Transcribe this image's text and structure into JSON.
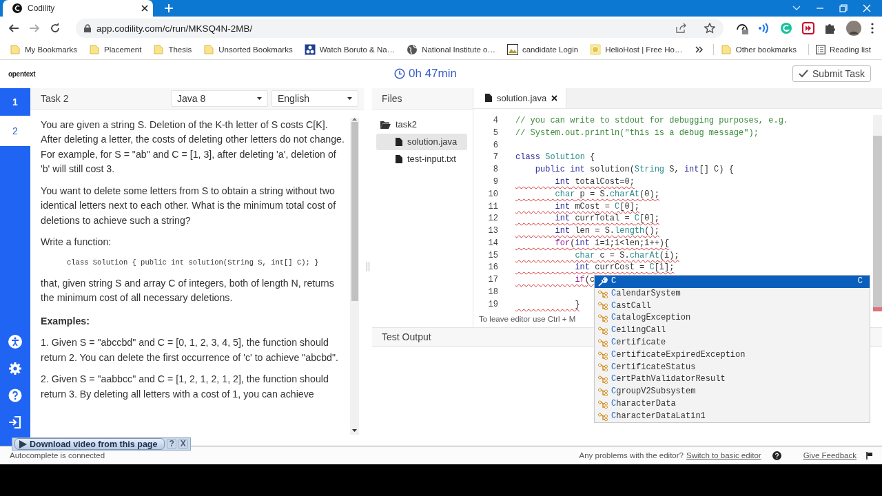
{
  "browser": {
    "tab": {
      "title": "Codility"
    },
    "url": "app.codility.com/c/run/MKSQ4N-2MB/",
    "bookmarks": [
      {
        "label": "My Bookmarks",
        "kind": "folder"
      },
      {
        "label": "Placement",
        "kind": "folder"
      },
      {
        "label": "Thesis",
        "kind": "folder"
      },
      {
        "label": "Unsorted Bookmarks",
        "kind": "folder"
      },
      {
        "label": "Watch Boruto & Na…",
        "kind": "app"
      },
      {
        "label": "National Institute o…",
        "kind": "globe"
      },
      {
        "label": "candidate Login",
        "kind": "image"
      },
      {
        "label": "HelioHost | Free Ho…",
        "kind": "sun"
      }
    ],
    "other_bookmarks": "Other bookmarks",
    "reading_list": "Reading list"
  },
  "header": {
    "brand": "opentext",
    "timer": "0h 47min",
    "submit": "Submit Task"
  },
  "tasks": [
    {
      "label": "1",
      "selected": false
    },
    {
      "label": "2",
      "selected": true
    }
  ],
  "task": {
    "title": "Task 2",
    "language": "Java 8",
    "locale": "English",
    "description": [
      {
        "kind": "text",
        "text": "You are given a string S. Deletion of the K-th letter of S costs C[K]. After deleting a letter, the costs of deleting other letters do not change. For example, for S = \"ab\" and C = [1, 3], after deleting 'a', deletion of 'b' will still cost 3."
      },
      {
        "kind": "text",
        "text": "You want to delete some letters from S to obtain a string without two identical letters next to each other. What is the minimum total cost of deletions to achieve such a string?"
      },
      {
        "kind": "text",
        "text": "Write a function:"
      },
      {
        "kind": "code",
        "text": "class Solution { public int solution(String S, int[] C); }"
      },
      {
        "kind": "text",
        "text": "that, given string S and array C of integers, both of length N, returns the minimum cost of all necessary deletions."
      },
      {
        "kind": "heading",
        "text": "Examples:"
      },
      {
        "kind": "text",
        "text": "1. Given S = \"abccbd\" and C = [0, 1, 2, 3, 4, 5], the function should return 2. You can delete the first occurrence of 'c' to achieve \"abcbd\"."
      },
      {
        "kind": "text",
        "text": "2. Given S = \"aabbcc\" and C = [1, 2, 1, 2, 1, 2], the function should return 3. By deleting all letters with a cost of 1, you can achieve"
      }
    ]
  },
  "files": {
    "heading": "Files",
    "tree": [
      {
        "label": "task2",
        "kind": "folder",
        "expanded": true,
        "selected": false,
        "children": [
          {
            "label": "solution.java",
            "kind": "file",
            "selected": true
          },
          {
            "label": "test-input.txt",
            "kind": "file",
            "selected": false
          }
        ]
      }
    ]
  },
  "editor": {
    "tab": "solution.java",
    "hint": "To leave editor use Ctrl + M",
    "lines": [
      {
        "number": "4",
        "error": false,
        "segments": [
          {
            "kind": "comment",
            "text": "// you can write to stdout for debugging purposes, e.g."
          }
        ]
      },
      {
        "number": "5",
        "error": false,
        "segments": [
          {
            "kind": "comment",
            "text": "// System.out.println(\"this is a debug message\");"
          }
        ]
      },
      {
        "number": "6",
        "error": false
      },
      {
        "number": "7",
        "error": false,
        "segments": [
          {
            "kind": "keyword",
            "text": "class"
          },
          {
            "kind": "ident",
            "text": " Solution"
          },
          {
            "kind": "plain",
            "text": " {"
          }
        ]
      },
      {
        "number": "8",
        "error": false,
        "segments": [
          {
            "kind": "keyword",
            "text": "    public int"
          },
          {
            "kind": "plain",
            "text": " solution("
          },
          {
            "kind": "ident",
            "text": "String"
          },
          {
            "kind": "plain",
            "text": " S, "
          },
          {
            "kind": "keyword",
            "text": "int"
          },
          {
            "kind": "plain",
            "text": "[] C) {"
          }
        ]
      },
      {
        "number": "9",
        "error": true,
        "segments": [
          {
            "kind": "keyword",
            "text": "        int"
          },
          {
            "kind": "plain",
            "text": " totalCost=0;"
          }
        ]
      },
      {
        "number": "10",
        "error": true,
        "segments": [
          {
            "kind": "ident",
            "text": "        char"
          },
          {
            "kind": "plain",
            "text": " p = S."
          },
          {
            "kind": "ident",
            "text": "charAt"
          },
          {
            "kind": "plain",
            "text": "(0);"
          }
        ]
      },
      {
        "number": "11",
        "error": true,
        "segments": [
          {
            "kind": "keyword",
            "text": "        int"
          },
          {
            "kind": "plain",
            "text": " mCost = "
          },
          {
            "kind": "ident",
            "text": "C"
          },
          {
            "kind": "plain",
            "text": "[0];"
          }
        ]
      },
      {
        "number": "12",
        "error": true,
        "segments": [
          {
            "kind": "keyword",
            "text": "        int"
          },
          {
            "kind": "plain",
            "text": " currTotal = "
          },
          {
            "kind": "ident",
            "text": "C"
          },
          {
            "kind": "plain",
            "text": "[0];"
          }
        ]
      },
      {
        "number": "13",
        "error": true,
        "segments": [
          {
            "kind": "keyword",
            "text": "        int"
          },
          {
            "kind": "plain",
            "text": " len = S."
          },
          {
            "kind": "ident",
            "text": "length"
          },
          {
            "kind": "plain",
            "text": "();"
          }
        ]
      },
      {
        "number": "14",
        "error": true,
        "segments": [
          {
            "kind": "control",
            "text": "        for"
          },
          {
            "kind": "plain",
            "text": "("
          },
          {
            "kind": "keyword",
            "text": "int"
          },
          {
            "kind": "plain",
            "text": " i=1;i<len;i++){"
          }
        ]
      },
      {
        "number": "15",
        "error": true,
        "segments": [
          {
            "kind": "ident",
            "text": "            char"
          },
          {
            "kind": "plain",
            "text": " c = S."
          },
          {
            "kind": "ident",
            "text": "charAt"
          },
          {
            "kind": "plain",
            "text": "(i);"
          }
        ]
      },
      {
        "number": "16",
        "error": true,
        "segments": [
          {
            "kind": "keyword",
            "text": "            int"
          },
          {
            "kind": "plain",
            "text": " currCost = "
          },
          {
            "kind": "ident",
            "text": "C"
          },
          {
            "kind": "plain",
            "text": "[i];"
          }
        ]
      },
      {
        "number": "17",
        "error": true,
        "segments": [
          {
            "kind": "control",
            "text": "            if"
          },
          {
            "kind": "plain",
            "text": "(c"
          }
        ]
      },
      {
        "number": "18",
        "error": false
      },
      {
        "number": "19",
        "error": true,
        "segments": [
          {
            "kind": "plain",
            "text": "            }"
          }
        ]
      }
    ],
    "autocomplete": [
      {
        "label": "C",
        "kind": "variable",
        "detail": "C",
        "selected": true
      },
      {
        "label": "CalendarSystem",
        "kind": "class",
        "selected": false
      },
      {
        "label": "CastCall",
        "kind": "class",
        "selected": false
      },
      {
        "label": "CatalogException",
        "kind": "class",
        "selected": false
      },
      {
        "label": "CeilingCall",
        "kind": "class",
        "selected": false
      },
      {
        "label": "Certificate",
        "kind": "class",
        "selected": false
      },
      {
        "label": "CertificateExpiredException",
        "kind": "class",
        "selected": false
      },
      {
        "label": "CertificateStatus",
        "kind": "class",
        "selected": false
      },
      {
        "label": "CertPathValidatorResult",
        "kind": "class",
        "selected": false
      },
      {
        "label": "CgroupV2Subsystem",
        "kind": "class",
        "selected": false
      },
      {
        "label": "CharacterData",
        "kind": "class",
        "selected": false
      },
      {
        "label": "CharacterDataLatin1",
        "kind": "class",
        "selected": false
      }
    ]
  },
  "test_output": {
    "title": "Test Output"
  },
  "status": {
    "left": "Autocomplete is connected",
    "question": "Any problems with the editor?",
    "switch_link": "Switch to basic editor",
    "feedback_link": "Give Feedback"
  },
  "overlay": {
    "label": "Download video from this page",
    "help": "?",
    "close": "X"
  }
}
